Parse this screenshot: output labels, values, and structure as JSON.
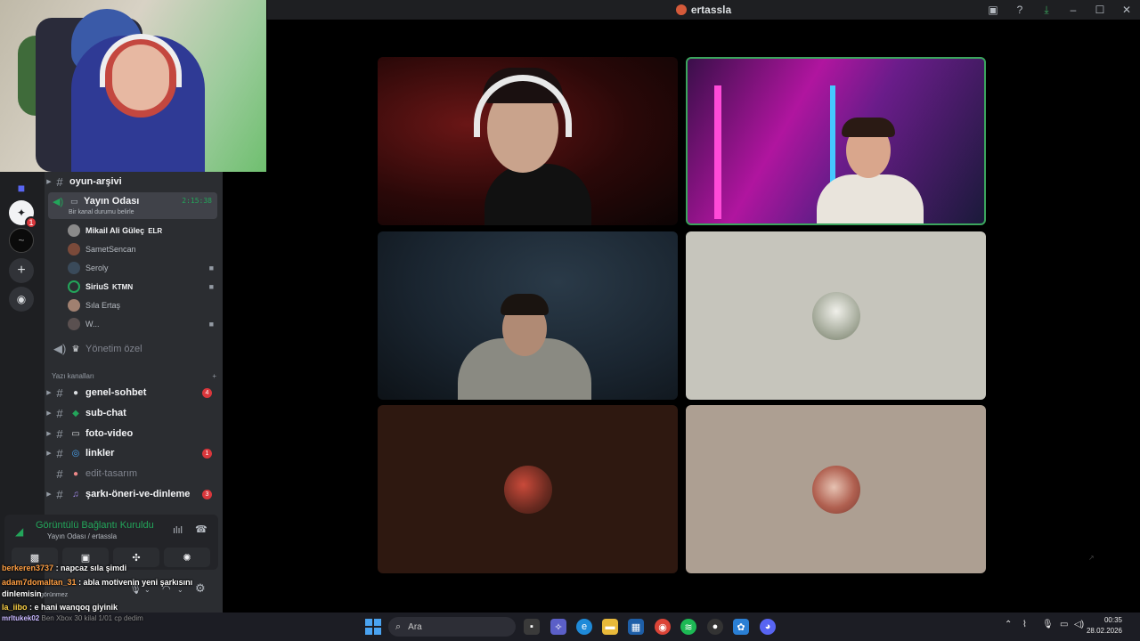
{
  "window": {
    "title": "ertassla"
  },
  "server_rail": {
    "s1_badge": "1"
  },
  "channels": {
    "top_channel": "oyun-arşivi",
    "voice_channel": {
      "name": "Yayın Odası",
      "status": "Bir kanal durumu belirle",
      "duration": "2:15:38"
    },
    "members": [
      {
        "name": "Mikail Ali Güleç",
        "tag": "ELR",
        "camera": false
      },
      {
        "name": "SametSencan",
        "tag": "",
        "camera": false
      },
      {
        "name": "Seroly",
        "tag": "",
        "camera": true
      },
      {
        "name": "SiriuS",
        "tag": "KTMN",
        "camera": true
      },
      {
        "name": "Sıla Ertaş",
        "tag": "",
        "camera": false
      },
      {
        "name": "W...",
        "tag": "",
        "camera": true
      }
    ],
    "management_channel": "Yönetim özel",
    "category_label": "Yazı kanalları",
    "text_channels": [
      {
        "name": "genel-sohbet",
        "badge": "4",
        "muted": false
      },
      {
        "name": "sub-chat",
        "badge": "",
        "muted": false
      },
      {
        "name": "foto-video",
        "badge": "",
        "muted": false
      },
      {
        "name": "linkler",
        "badge": "1",
        "muted": false
      },
      {
        "name": "edit-tasarım",
        "badge": "",
        "muted": true
      },
      {
        "name": "şarkı-öneri-ve-dinleme",
        "badge": "3",
        "muted": false
      }
    ]
  },
  "voice_panel": {
    "connection": "Görüntülü Bağlantı Kuruldu",
    "location": "Yayın Odası / ertassla"
  },
  "user_panel": {
    "status": "görünmez"
  },
  "chat": [
    {
      "user": "berkeren3737",
      "message": ": napcaz sıla şimdi",
      "color": "#ff9f43"
    },
    {
      "user": "adam7domaltan_31",
      "message": ": abla motivenin yeni şarkısını",
      "color": "#ff9f43"
    },
    {
      "user": "",
      "message": "dinlemisin",
      "color": "#ffffff"
    },
    {
      "user": "la_iibo",
      "message": ": e hani wanqoq giyinik",
      "color": "#ffd447"
    }
  ],
  "taskbar": {
    "chat_user": "mrltukek02",
    "chat_message": "Ben Xbox 30 kilal 1/01 cp dedim",
    "search_placeholder": "Ara",
    "time": "00:35",
    "date": "28.02.2026"
  }
}
